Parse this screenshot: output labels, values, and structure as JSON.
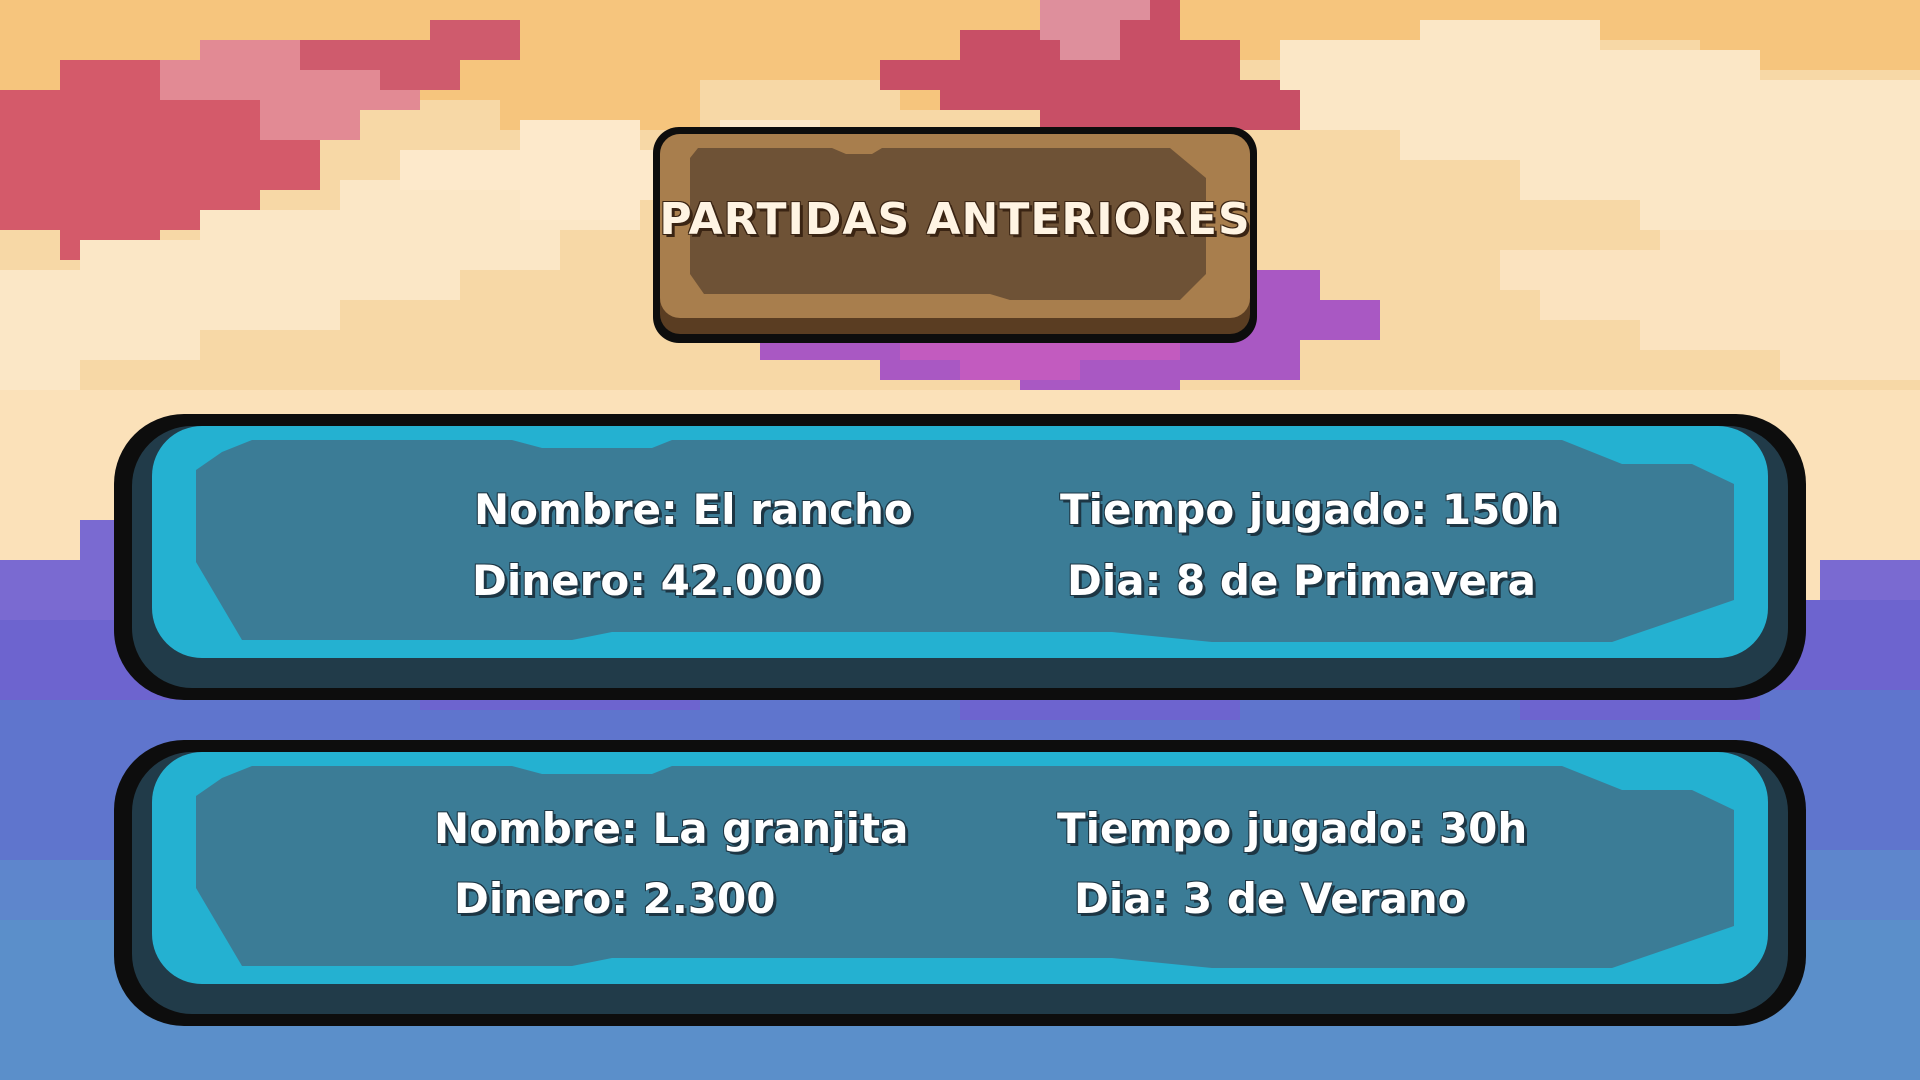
{
  "screen": {
    "title": "PARTIDAS ANTERIORES"
  },
  "saves": [
    {
      "nombre": "Nombre: El rancho",
      "dinero": "Dinero: 42.000",
      "tiempo": "Tiempo jugado: 150h",
      "dia": "Dia: 8 de Primavera"
    },
    {
      "nombre": "Nombre: La granjita",
      "dinero": "Dinero: 2.300",
      "tiempo": "Tiempo jugado: 30h",
      "dia": "Dia: 3 de Verano"
    }
  ],
  "colors": {
    "plaque_wood": "#a87e4d",
    "plaque_inner": "#6e5236",
    "card_outer": "#24b1d1",
    "card_inner": "#3b7c96",
    "card_shadow": "#213b49",
    "outline": "#0d0d0d"
  }
}
